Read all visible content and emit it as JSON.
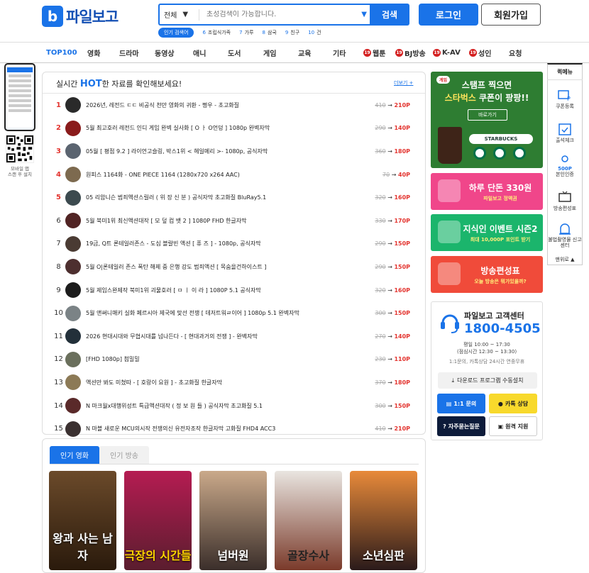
{
  "header": {
    "logo_text": "파일보고",
    "logo_mark": "b",
    "search_category": "전체",
    "search_placeholder": "초성검색이 가능합니다.",
    "search_button": "검색",
    "login_button": "로그인",
    "join_button": "회원가입",
    "popular_tag": "인기 검색어",
    "popular_keywords": [
      {
        "num": "6",
        "text": "조립식가족"
      },
      {
        "num": "7",
        "text": "가루"
      },
      {
        "num": "8",
        "text": "삼국"
      },
      {
        "num": "9",
        "text": "친구"
      },
      {
        "num": "10",
        "text": "건"
      }
    ]
  },
  "nav": {
    "items": [
      "TOP100",
      "영화",
      "드라마",
      "동영상",
      "애니",
      "도서",
      "게임",
      "교육",
      "기타",
      "웹툰",
      "BJ방송",
      "K-AV",
      "성인",
      "요청"
    ],
    "badge": "19"
  },
  "left_ad": {
    "line1": "모바일 앱",
    "line2": "스캔 후 설치"
  },
  "hot": {
    "title_pre": "실시간 ",
    "title_hot": "HOT",
    "title_post": "한 자료를 확인해보세요!",
    "more": "더보기 +",
    "arrow": "→",
    "rows": [
      {
        "rank": "1",
        "title": "2026년, 레전드 ㄷㄷ 비공식 천만 영화의 귀환 - 쩡우 - 초고화질",
        "old": "410",
        "new": "210P",
        "thumb": "#2a2a2a"
      },
      {
        "rank": "2",
        "title": "5월 최고호러 레전드 인디 게임 완벽 실사화 [ O ㅏ O언덩 ] 1080p 완벽자막",
        "old": "290",
        "new": "140P",
        "thumb": "#8a1b1b"
      },
      {
        "rank": "3",
        "title": "05월 [ 평점 9.2 ] 라이언고슬링, 박스1위 < 헤일메리 >- 1080p, 공식자막",
        "old": "360",
        "new": "180P",
        "thumb": "#5b6470"
      },
      {
        "rank": "4",
        "title": "원피스 1164화 - ONE PIECE 1164 (1280x720 x264 AAC)",
        "old": "70",
        "new": "40P",
        "thumb": "#7d6a4f"
      },
      {
        "rank": "5",
        "title": "05 리암니슨 범죄액션스릴러 ( 위 장 신 분 ) 공식자막 초고화질 BluRay5.1",
        "old": "320",
        "new": "160P",
        "thumb": "#3c4a4f"
      },
      {
        "rank": "6",
        "title": "5월 북미1위 최신액션대작 [ 모 덮 컴 뱃 2 ] 1080P FHD 한글자막",
        "old": "330",
        "new": "170P",
        "thumb": "#512424"
      },
      {
        "rank": "7",
        "title": "19금, Q트 론테일러존스 - 도심 블랄빈 액션 [ 퓨 즈 ] - 1080p, 공식자막",
        "old": "290",
        "new": "150P",
        "thumb": "#4a3b33"
      },
      {
        "rank": "8",
        "title": "5월 O|론테일러 존스 폭탄 해제 중 은행 강도 범죄액션 [ 목숨을건하이스트 ]",
        "old": "290",
        "new": "150P",
        "thumb": "#4d2f2f"
      },
      {
        "rank": "9",
        "title": "5월 제임스완제작 북미1위 괴물호러 [ ㅁ ㅣ 이 라 ] 1080P 5.1 공식자막",
        "old": "320",
        "new": "160P",
        "thumb": "#1c1c1c"
      },
      {
        "rank": "10",
        "title": "5월 앤써니매키 실화 페르시아 제국에 맞선 전쟁 [ 데저트워ㄹ이어 ] 1080p 5.1 완벽자막",
        "old": "300",
        "new": "150P",
        "thumb": "#7b8386"
      },
      {
        "rank": "11",
        "title": "2026 현대시대와 무협시대를 넘나든다 - [ 현대과거의 전쟁 ] - 완벽자막",
        "old": "270",
        "new": "140P",
        "thumb": "#23303a"
      },
      {
        "rank": "12",
        "title": "[FHD 1080p] 첨밀밀",
        "old": "230",
        "new": "110P",
        "thumb": "#6a6f5c"
      },
      {
        "rank": "13",
        "title": "액션만 봐도 미쳤따 - [ 호랑이 요원 ] - 초고화질 한글자막",
        "old": "370",
        "new": "180P",
        "thumb": "#8c7a56"
      },
      {
        "rank": "14",
        "title": "N 마크월x대행위성트 특급액션대작 ( 정 보 원 들 ) 공식자막 초고화질 5.1",
        "old": "300",
        "new": "150P",
        "thumb": "#5a2a2a"
      },
      {
        "rank": "15",
        "title": "N 마블 새로운 MCU의시작 전쟁의신 유전자조작 한글자막 고화질 FHD4 ACC3",
        "old": "410",
        "new": "210P",
        "thumb": "#3a3030"
      }
    ]
  },
  "popular_tabs": {
    "tab_movie": "인기 영화",
    "tab_broadcast": "인기 방송",
    "posters": [
      "왕과 사는 남자",
      "극장의 시간들",
      "넘버원",
      "골장수사",
      "소년심판"
    ]
  },
  "banners": {
    "starbucks_chip": "게임",
    "starbucks_line1": "스탬프 찍으면",
    "starbucks_line2a": "스타벅스",
    "starbucks_line2b": " 쿠폰이 팡팡!!",
    "starbucks_go": "바로가기",
    "starbucks_brand": "STARBUCKS",
    "b2_big": "하루 단돈 330원",
    "b2_small": "파일보고 정액권",
    "b3_big": "지식인 이벤트 시즌2",
    "b3_small": "최대 10,000P 포인트 받기",
    "b4_big": "방송편성표",
    "b4_small": "오늘 방송은 뭐가있을까?"
  },
  "customer_center": {
    "title": "파일보고 고객센터",
    "phone": "1800-4505",
    "hours1": "평일 10:00 ~ 17:30",
    "hours2": "(점심시간 12:30 ~ 13:30)",
    "hours3": "1:1문의, 카톡상담 24시간 연중무휴",
    "download": "다운로드 프로그램 수동설치",
    "btn_inquiry": "1:1 문의",
    "btn_kakao": "카톡 상담",
    "btn_faq": "자주묻는질문",
    "btn_remote": "원격 지원"
  },
  "quick_menu": {
    "title": "퀵메뉴",
    "items": [
      "쿠폰등록",
      "출석체크",
      "본인인증",
      "방송편성표",
      "불법촬영물 신고센터"
    ],
    "cert_tag": "500P",
    "top": "맨위로 ▲"
  },
  "colors": {
    "accent": "#1a73e8",
    "rank_top": "#e3342f",
    "adult_badge": "#d42020"
  }
}
